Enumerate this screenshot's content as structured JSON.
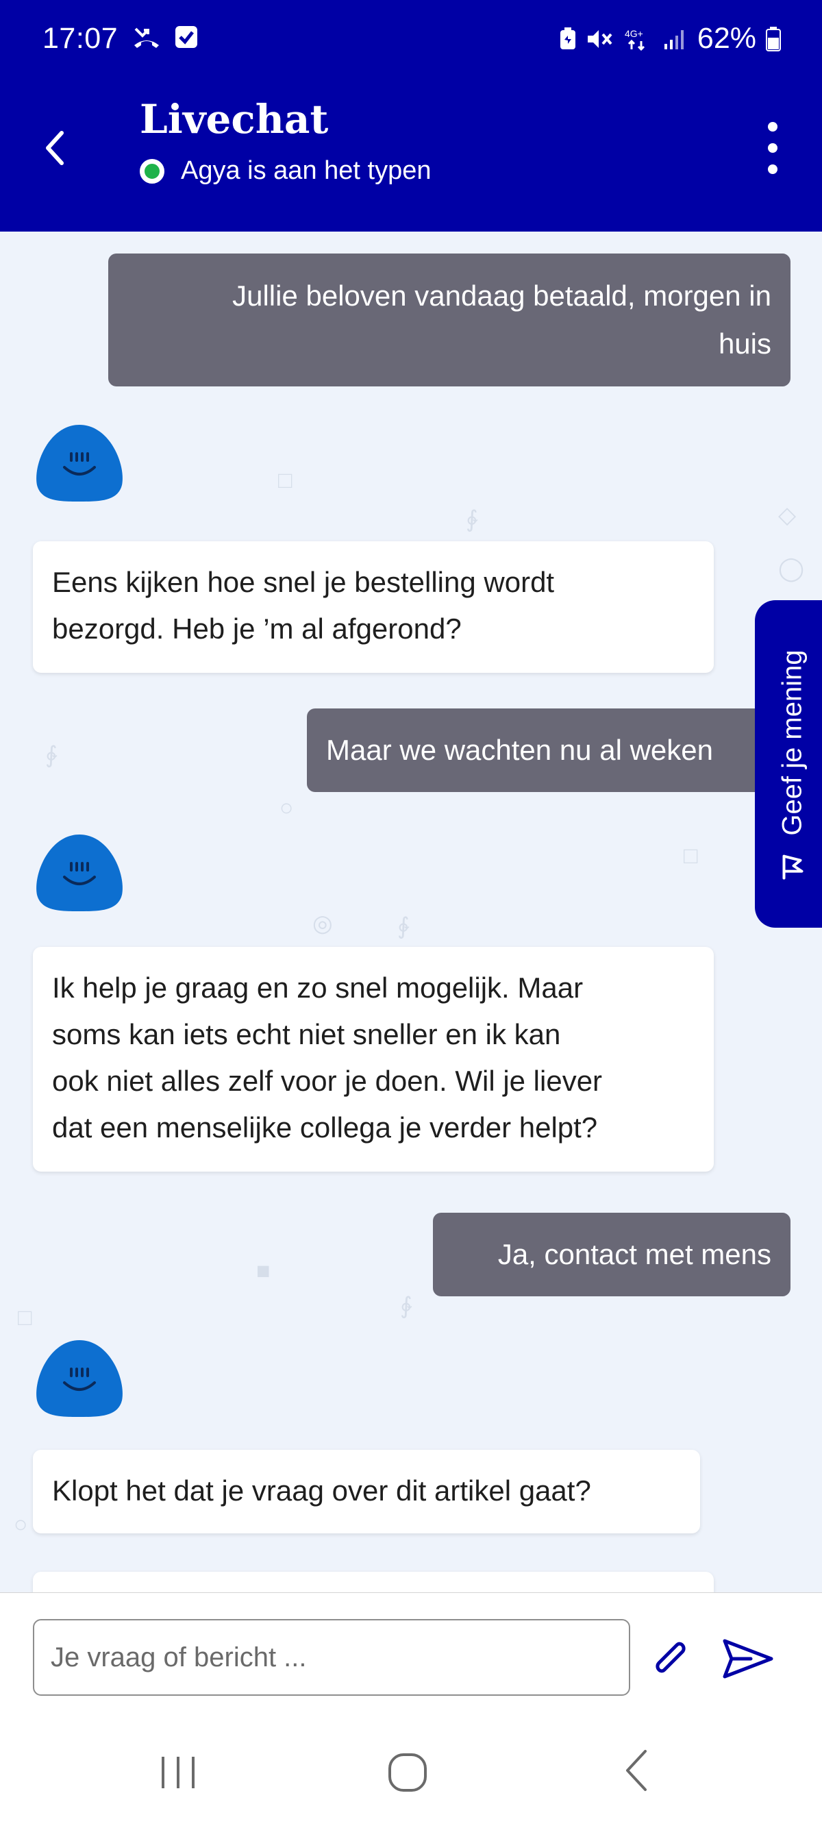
{
  "status_bar": {
    "time": "17:07",
    "battery_percent": "62%",
    "network": "4G+"
  },
  "header": {
    "title": "Livechat",
    "subtitle": "Agya is aan het typen"
  },
  "messages": [
    {
      "from": "user",
      "lines": [
        "Jullie beloven vandaag betaald, morgen in",
        "huis"
      ]
    },
    {
      "from": "agent",
      "lines": [
        "Eens kijken hoe snel je bestelling wordt",
        "bezorgd. Heb je ’m al afgerond?"
      ]
    },
    {
      "from": "user",
      "lines": [
        "Maar we wachten nu al weken"
      ]
    },
    {
      "from": "agent",
      "lines": [
        "Ik help je graag en zo snel mogelijk. Maar",
        "soms kan iets echt niet sneller en ik kan",
        "ook niet alles zelf voor je doen. Wil je liever",
        "dat een menselijke collega je verder helpt?"
      ]
    },
    {
      "from": "user",
      "lines": [
        "Ja, contact met mens"
      ]
    },
    {
      "from": "agent",
      "lines": [
        "Klopt het dat je vraag over dit artikel gaat?"
      ]
    }
  ],
  "feedback_tab": {
    "label": "Geef je mening"
  },
  "composer": {
    "placeholder": "Je vraag of bericht ..."
  },
  "colors": {
    "brand": "#0000a5",
    "user_bubble": "#696876",
    "agent_bubble": "#ffffff",
    "chat_background": "#eef3fb",
    "online": "#1fb24a",
    "avatar": "#0d6fd0"
  },
  "icons": [
    "back-arrow-icon",
    "more-vertical-icon",
    "avatar-icon",
    "feedback-flag-icon",
    "paperclip-icon",
    "send-icon",
    "recents-icon",
    "home-icon",
    "nav-back-icon"
  ]
}
